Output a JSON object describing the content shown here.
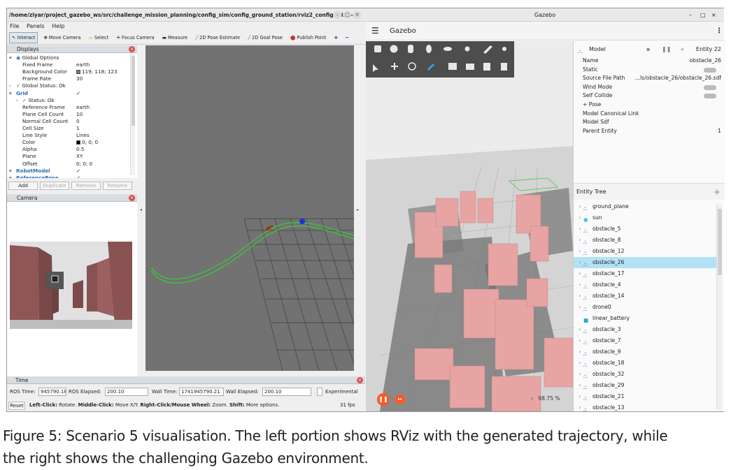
{
  "rviz": {
    "title": "/home/ziyar/project_gazebo_ws/src/challenge_mission_planning/config_sim/config_ground_station/rviz2_config.rviz* -...",
    "menu": [
      "File",
      "Panels",
      "Help"
    ],
    "tools": [
      "Interact",
      "Move Camera",
      "Select",
      "Focus Camera",
      "Measure",
      "2D Pose Estimate",
      "2D Goal Pose",
      "Publish Point"
    ],
    "displays_title": "Displays",
    "tree": [
      {
        "label": "Global Options",
        "value": "",
        "indent": 1,
        "kind": "header"
      },
      {
        "label": "Fixed Frame",
        "value": "earth",
        "indent": 2
      },
      {
        "label": "Background Color",
        "value": "119; 118; 123",
        "indent": 2,
        "swatch": "#77767b"
      },
      {
        "label": "Frame Rate",
        "value": "30",
        "indent": 2
      },
      {
        "label": "Global Status: Ok",
        "value": "",
        "indent": 1,
        "kind": "ok"
      },
      {
        "label": "Grid",
        "value": "✓",
        "indent": 1,
        "kind": "blue"
      },
      {
        "label": "Status: Ok",
        "value": "",
        "indent": 2,
        "kind": "ok"
      },
      {
        "label": "Reference Frame",
        "value": "earth",
        "indent": 2
      },
      {
        "label": "Plane Cell Count",
        "value": "10",
        "indent": 2
      },
      {
        "label": "Normal Cell Count",
        "value": "0",
        "indent": 2
      },
      {
        "label": "Cell Size",
        "value": "1",
        "indent": 2
      },
      {
        "label": "Line Style",
        "value": "Lines",
        "indent": 2
      },
      {
        "label": "Color",
        "value": "0; 0; 0",
        "indent": 2,
        "swatch": "#000000"
      },
      {
        "label": "Alpha",
        "value": "0.5",
        "indent": 2
      },
      {
        "label": "Plane",
        "value": "XY",
        "indent": 2
      },
      {
        "label": "Offset",
        "value": "0; 0; 0",
        "indent": 2
      },
      {
        "label": "RobotModel",
        "value": "✓",
        "indent": 1,
        "kind": "blue"
      },
      {
        "label": "ReferencePose",
        "value": "✓",
        "indent": 1,
        "kind": "blue"
      }
    ],
    "buttons": {
      "add": "Add",
      "duplicate": "Duplicate",
      "remove": "Remove",
      "rename": "Rename"
    },
    "camera_title": "Camera",
    "time_title": "Time",
    "time": {
      "ros_time_label": "ROS Time:",
      "ros_time": "945790.18",
      "ros_elapsed_label": "ROS Elapsed:",
      "ros_elapsed": "200.10",
      "wall_time_label": "Wall Time:",
      "wall_time": "1741945790.21",
      "wall_elapsed_label": "Wall Elapsed:",
      "wall_elapsed": "200.10",
      "experimental": "Experimental"
    },
    "status": {
      "reset": "Reset",
      "hint_a": "Left-Click:",
      "hint_a2": " Rotate. ",
      "hint_b": "Middle-Click:",
      "hint_b2": " Move X/Y. ",
      "hint_c": "Right-Click/Mouse Wheel:",
      "hint_c2": " Zoom. ",
      "hint_d": "Shift:",
      "hint_d2": " More options.",
      "fps": "31 fps"
    }
  },
  "gazebo": {
    "title": "Gazebo",
    "app_name": "Gazebo",
    "model_title": "Model",
    "entity_id": "Entity 22",
    "props": [
      {
        "label": "Name",
        "value": "obstacle_26"
      },
      {
        "label": "Static",
        "value": "",
        "toggle": true
      },
      {
        "label": "Source File Path",
        "value": "...ls/obstacle_26/obstacle_26.sdf"
      },
      {
        "label": "Wind Mode",
        "value": "",
        "toggle": true
      },
      {
        "label": "Self Collide",
        "value": "",
        "toggle": true
      },
      {
        "label": "+ Pose",
        "value": ""
      },
      {
        "label": "Model Canonical Link",
        "value": ""
      },
      {
        "label": "Model Sdf",
        "value": ""
      },
      {
        "label": "Parent Entity",
        "value": "1"
      }
    ],
    "entity_tree_title": "Entity Tree",
    "entities": [
      {
        "name": "ground_plane",
        "icon": "model"
      },
      {
        "name": "sun",
        "icon": "light"
      },
      {
        "name": "obstacle_5",
        "icon": "model"
      },
      {
        "name": "obstacle_8",
        "icon": "model"
      },
      {
        "name": "obstacle_12",
        "icon": "model"
      },
      {
        "name": "obstacle_26",
        "icon": "model",
        "selected": true
      },
      {
        "name": "obstacle_17",
        "icon": "model"
      },
      {
        "name": "obstacle_4",
        "icon": "model"
      },
      {
        "name": "obstacle_14",
        "icon": "model"
      },
      {
        "name": "drone0",
        "icon": "model"
      },
      {
        "name": "linear_battery",
        "icon": "cube"
      },
      {
        "name": "obstacle_3",
        "icon": "model"
      },
      {
        "name": "obstacle_7",
        "icon": "model"
      },
      {
        "name": "obstacle_9",
        "icon": "model"
      },
      {
        "name": "obstacle_18",
        "icon": "model"
      },
      {
        "name": "obstacle_32",
        "icon": "model"
      },
      {
        "name": "obstacle_29",
        "icon": "model"
      },
      {
        "name": "obstacle_21",
        "icon": "model"
      },
      {
        "name": "obstacle_13",
        "icon": "model"
      }
    ],
    "rtf": "98.75 %"
  },
  "caption": {
    "line1": "Figure 5: Scenario 5 visualisation. The left portion shows RViz with the generated trajectory, while",
    "line2": "the right shows the challenging Gazebo environment."
  },
  "colors": {
    "obstacle": "#e8a3a3",
    "trajectory": "#3ec63e",
    "selected": "#b3e1f5",
    "play": "#ff5722"
  }
}
